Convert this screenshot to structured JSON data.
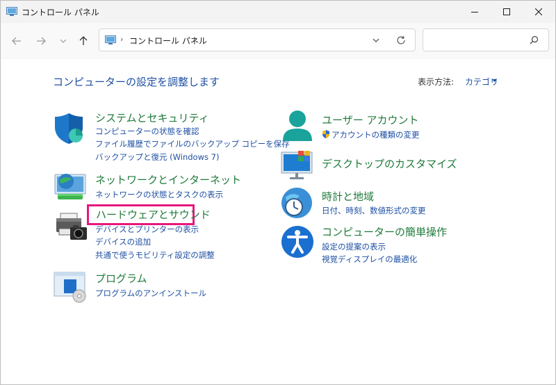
{
  "window": {
    "title": "コントロール パネル",
    "minimize_glyph": "—",
    "maximize_glyph": "□",
    "close_glyph": "✕"
  },
  "toolbar": {
    "address_separator_1": "›",
    "address_path": "コントロール パネル",
    "address_separator_2": "›",
    "search_placeholder": ""
  },
  "header": {
    "title": "コンピューターの設定を調整します",
    "view_by_label": "表示方法:",
    "view_by_value": "カテゴリ"
  },
  "categories": {
    "system_security": {
      "title": "システムとセキュリティ",
      "links": [
        "コンピューターの状態を確認",
        "ファイル履歴でファイルのバックアップ コピーを保存",
        "バックアップと復元 (Windows 7)"
      ]
    },
    "network": {
      "title": "ネットワークとインターネット",
      "links": [
        "ネットワークの状態とタスクの表示"
      ]
    },
    "hardware": {
      "title": "ハードウェアとサウンド",
      "links": [
        "デバイスとプリンターの表示",
        "デバイスの追加",
        "共通で使うモビリティ設定の調整"
      ]
    },
    "programs": {
      "title": "プログラム",
      "links": [
        "プログラムのアンインストール"
      ]
    },
    "user_accounts": {
      "title": "ユーザー アカウント",
      "links": [
        "アカウントの種類の変更"
      ]
    },
    "appearance": {
      "title": "デスクトップのカスタマイズ",
      "links": []
    },
    "clock_region": {
      "title": "時計と地域",
      "links": [
        "日付、時刻、数値形式の変更"
      ]
    },
    "ease_of_access": {
      "title": "コンピューターの簡単操作",
      "links": [
        "設定の提案の表示",
        "視覚ディスプレイの最適化"
      ]
    }
  },
  "colors": {
    "link_blue": "#1e4fa3",
    "category_green": "#1f7a3a",
    "highlight_pink": "#e8177d"
  }
}
